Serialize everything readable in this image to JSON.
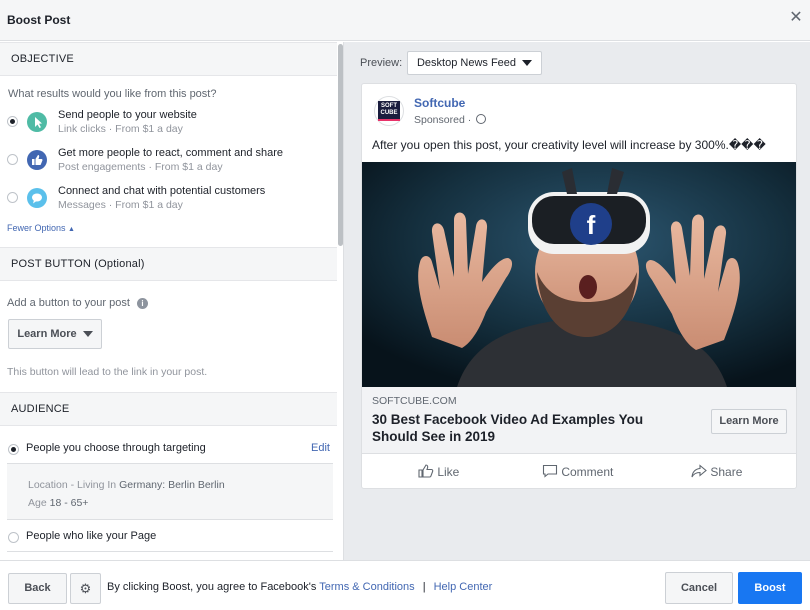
{
  "header": {
    "title": "Boost Post",
    "close_glyph": "✕"
  },
  "objective": {
    "heading": "OBJECTIVE",
    "question": "What results would you like from this post?",
    "options": [
      {
        "title": "Send people to your website",
        "sub": "Link clicks · From $1 a day",
        "icon": "pointer-icon",
        "color": "#4fbba5",
        "checked": true
      },
      {
        "title": "Get more people to react, comment and share",
        "sub": "Post engagements · From $1 a day",
        "icon": "thumbs-up-icon",
        "color": "#4267b2",
        "checked": false
      },
      {
        "title": "Connect and chat with potential customers",
        "sub": "Messages · From $1 a day",
        "icon": "chat-bubble-icon",
        "color": "#5bc0eb",
        "checked": false
      }
    ],
    "fewer_options": "Fewer Options"
  },
  "post_button": {
    "heading": "POST BUTTON (Optional)",
    "label": "Add a button to your post",
    "select_value": "Learn More",
    "help": "This button will lead to the link in your post."
  },
  "audience": {
    "heading": "AUDIENCE",
    "option1": "People you choose through targeting",
    "edit": "Edit",
    "location_prefix": "Location - Living In ",
    "location_value": "Germany: Berlin Berlin",
    "age_prefix": "Age ",
    "age_value": "18 - 65+",
    "option2": "People who like your Page"
  },
  "preview": {
    "label": "Preview:",
    "placement": "Desktop News Feed",
    "page_name": "Softcube",
    "logo_text_1": "SOFT",
    "logo_text_2": "CUBE",
    "sponsored": "Sponsored ·",
    "post_text": "After you open this post, your creativity level will increase by 300%.���",
    "link_domain": "SOFTCUBE.COM",
    "link_title": "30 Best Facebook Video Ad Examples You Should See in 2019",
    "cta": "Learn More",
    "actions": {
      "like": "Like",
      "comment": "Comment",
      "share": "Share"
    },
    "headset_logo": "f"
  },
  "footer": {
    "back": "Back",
    "agree_text": "By clicking Boost, you agree to Facebook's",
    "terms": "Terms & Conditions",
    "separator": "|",
    "help_center": "Help Center",
    "cancel": "Cancel",
    "boost": "Boost"
  },
  "colors": {
    "accent": "#1877f2",
    "link": "#4267b2",
    "panel": "#f5f6f7",
    "preview_bg": "#e9ebee"
  }
}
